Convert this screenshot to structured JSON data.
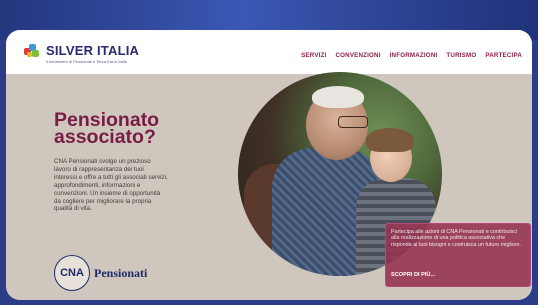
{
  "header": {
    "brand": "SILVER ITALIA",
    "brand_tagline": "Il benessere di Pensionati e Terza Età in Italia",
    "nav": [
      "SERVIZI",
      "CONVENZIONI",
      "INFORMAZIONI",
      "TURISMO",
      "PARTECIPA"
    ]
  },
  "hero": {
    "title_line1": "Pensionato",
    "title_line2": "associato?",
    "description": "CNA Pensionati svolge un prezioso lavoro di rappresentanza dei tuoi interessi e offre a tutti gli associati servizi, approfondimenti, informazioni e convenzioni. Un insieme di opportunità da cogliere per migliorare la propria qualità di vita.",
    "cna_badge": "CNA",
    "cna_name": "Pensionati"
  },
  "info_box": {
    "text": "Partecipa alle azioni di CNA Pensionati e contribuisci alla realizzazione di una politica associativa che risponda ai tuoi bisogni e costruisca un futuro migliore.",
    "link_label": "SCOPRI DI PIÙ..."
  },
  "colors": {
    "brand": "#2b2a6f",
    "accent": "#7a1d45",
    "hero_bg": "#cfc7be",
    "info_bg": "#963250"
  }
}
